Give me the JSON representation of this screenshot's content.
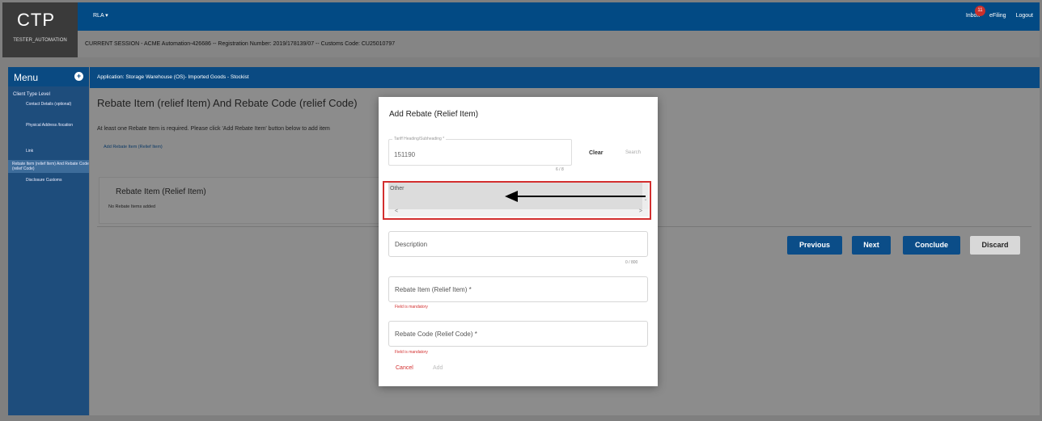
{
  "brand": {
    "logo": "CTP",
    "user": "TESTER_AUTOMATION"
  },
  "topbar": {
    "menu": "RLA ▾",
    "inbox": "Inbox",
    "inbox_count": "11",
    "efiling": "eFiling",
    "logout": "Logout"
  },
  "session": {
    "text": "CURRENT SESSION - ACME Automation-426686 -- Registration Number: 2019/178139/07 -- Customs Code: CU25010797"
  },
  "sidebar": {
    "header": "Menu",
    "level": "Client Type Level",
    "items": [
      {
        "label": "Contact Details (optional)"
      },
      {
        "label": "Physical Address /location"
      },
      {
        "label": "Link"
      },
      {
        "label": "Rebate Item (relief Item) And Rebate Code (relief Code)"
      },
      {
        "label": "Disclosure Customs"
      }
    ]
  },
  "appbar": {
    "text": "Application: Storage Warehouse (OS)- Imported Goods - Stockist"
  },
  "main": {
    "title": "Rebate Item (relief Item) And Rebate Code (relief Code)",
    "hint": "At least one Rebate Item is required. Please click 'Add Rebate Item' button below to add item",
    "add_link": "Add Rebate Item (Relief Item)",
    "card_title": "Rebate Item (Relief Item)",
    "card_status": "No Rebate Items added",
    "buttons": {
      "previous": "Previous",
      "next": "Next",
      "conclude": "Conclude",
      "discard": "Discard"
    }
  },
  "modal": {
    "title": "Add Rebate (Relief Item)",
    "tariff_label": "Tariff Heading/Subheading *",
    "tariff_value": "151190",
    "tariff_counter": "6 / 8",
    "clear": "Clear",
    "search": "Search",
    "list_option": "Other",
    "description_placeholder": "Description",
    "description_counter": "0 / 800",
    "rebate_item_placeholder": "Rebate Item (Relief Item) *",
    "rebate_item_error": "Field is mandatory",
    "rebate_code_placeholder": "Rebate Code (Relief Code) *",
    "rebate_code_error": "Field is mandatory",
    "cancel": "Cancel",
    "add": "Add"
  },
  "colors": {
    "primary": "#0b4d88",
    "error": "#d32f2f",
    "highlight": "#d32f2f"
  }
}
